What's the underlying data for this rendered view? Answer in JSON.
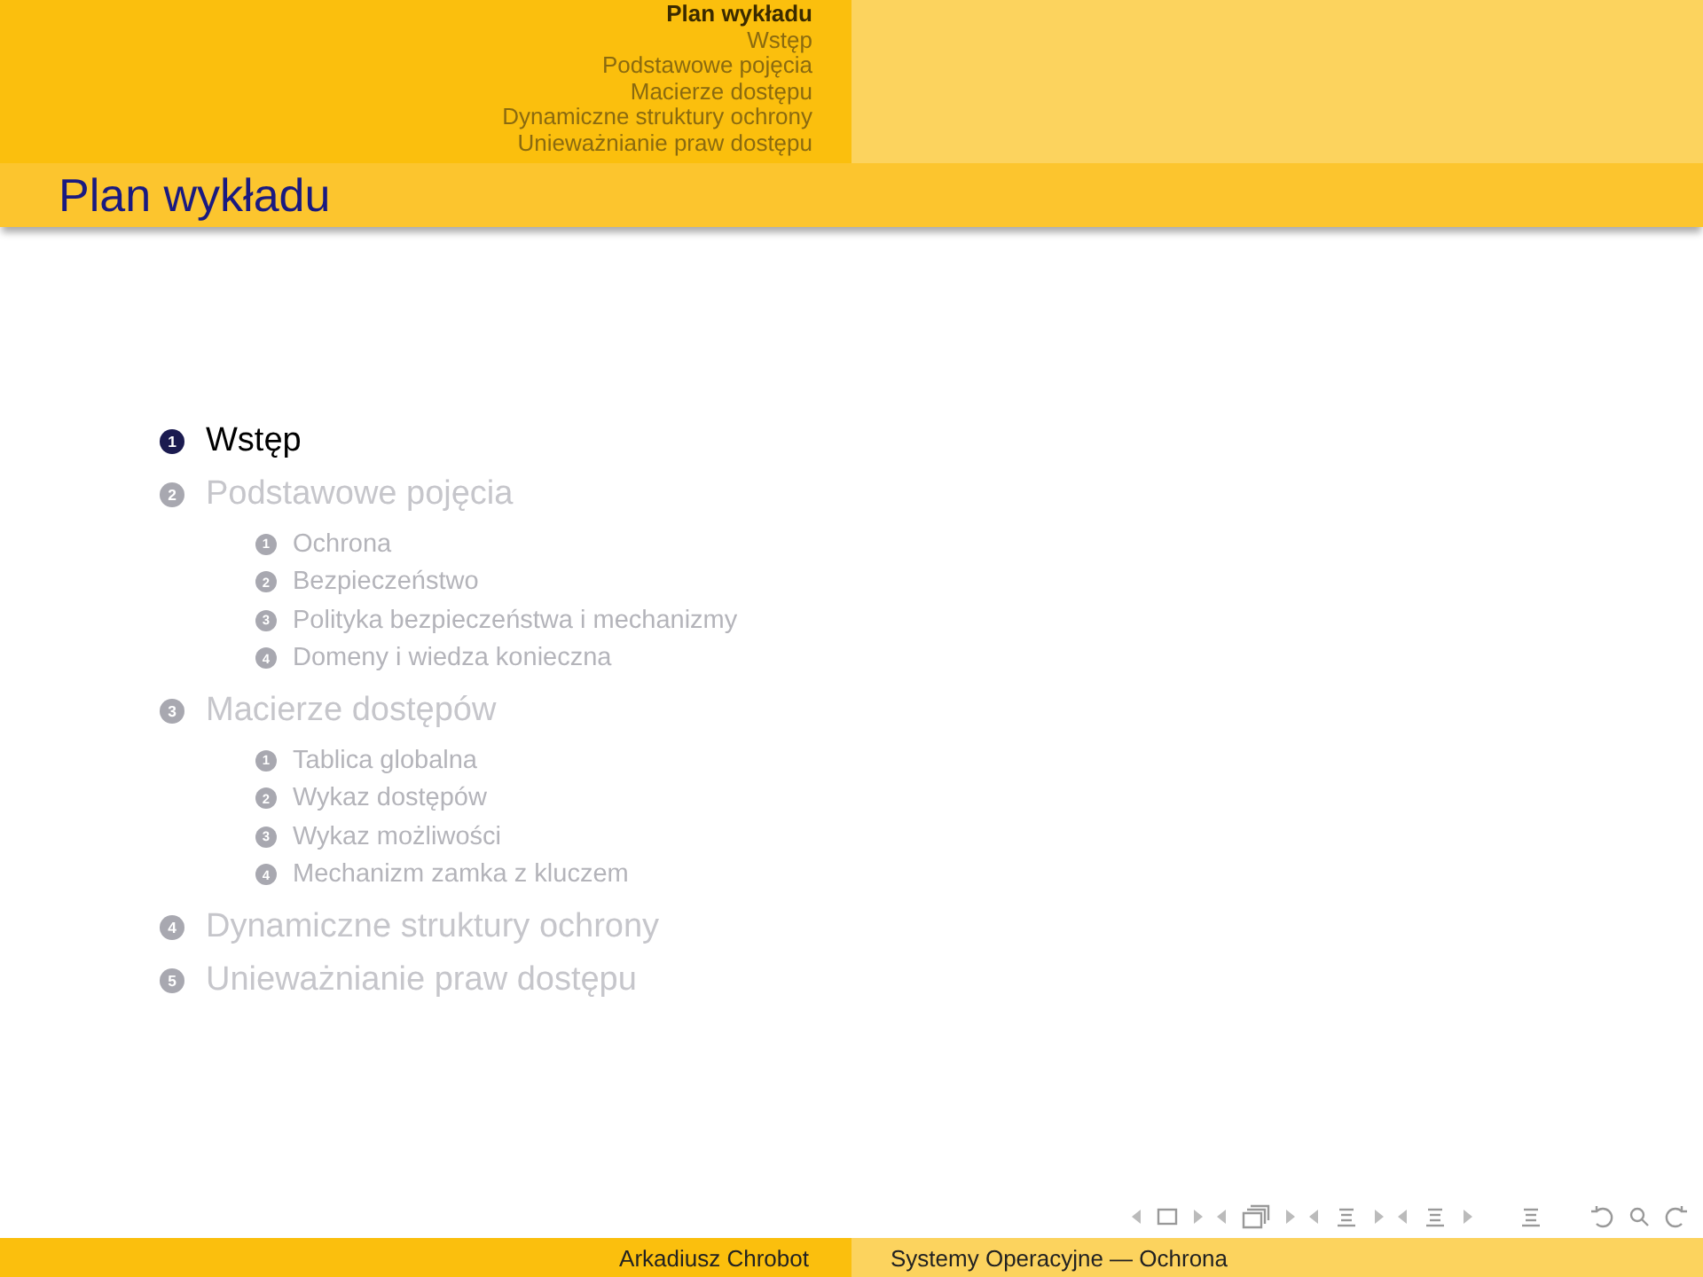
{
  "header": {
    "nav": [
      {
        "label": "Plan wykładu",
        "selected": true
      },
      {
        "label": "Wstęp",
        "selected": false
      },
      {
        "label": "Podstawowe pojęcia",
        "selected": false
      },
      {
        "label": "Macierze dostępu",
        "selected": false
      },
      {
        "label": "Dynamiczne struktury ochrony",
        "selected": false
      },
      {
        "label": "Unieważnianie praw dostępu",
        "selected": false
      }
    ]
  },
  "frame_title": "Plan wykładu",
  "outline": [
    {
      "number": "1",
      "label": "Wstęp",
      "selected": true
    },
    {
      "number": "2",
      "label": "Podstawowe pojęcia",
      "selected": false,
      "children": [
        {
          "number": "1",
          "label": "Ochrona",
          "selected": false
        },
        {
          "number": "2",
          "label": "Bezpieczeństwo",
          "selected": false
        },
        {
          "number": "3",
          "label": "Polityka bezpieczeństwa i mechanizmy",
          "selected": false
        },
        {
          "number": "4",
          "label": "Domeny i wiedza konieczna",
          "selected": false
        }
      ]
    },
    {
      "number": "3",
      "label": "Macierze dostępów",
      "selected": false,
      "children": [
        {
          "number": "1",
          "label": "Tablica globalna",
          "selected": false
        },
        {
          "number": "2",
          "label": "Wykaz dostępów",
          "selected": false
        },
        {
          "number": "3",
          "label": "Wykaz możliwości",
          "selected": false
        },
        {
          "number": "4",
          "label": "Mechanizm zamka z kluczem",
          "selected": false
        }
      ]
    },
    {
      "number": "4",
      "label": "Dynamiczne struktury ochrony",
      "selected": false
    },
    {
      "number": "5",
      "label": "Unieważnianie praw dostępu",
      "selected": false
    }
  ],
  "footer": {
    "author": "Arkadiusz Chrobot",
    "title": "Systemy Operacyjne — Ochrona"
  }
}
